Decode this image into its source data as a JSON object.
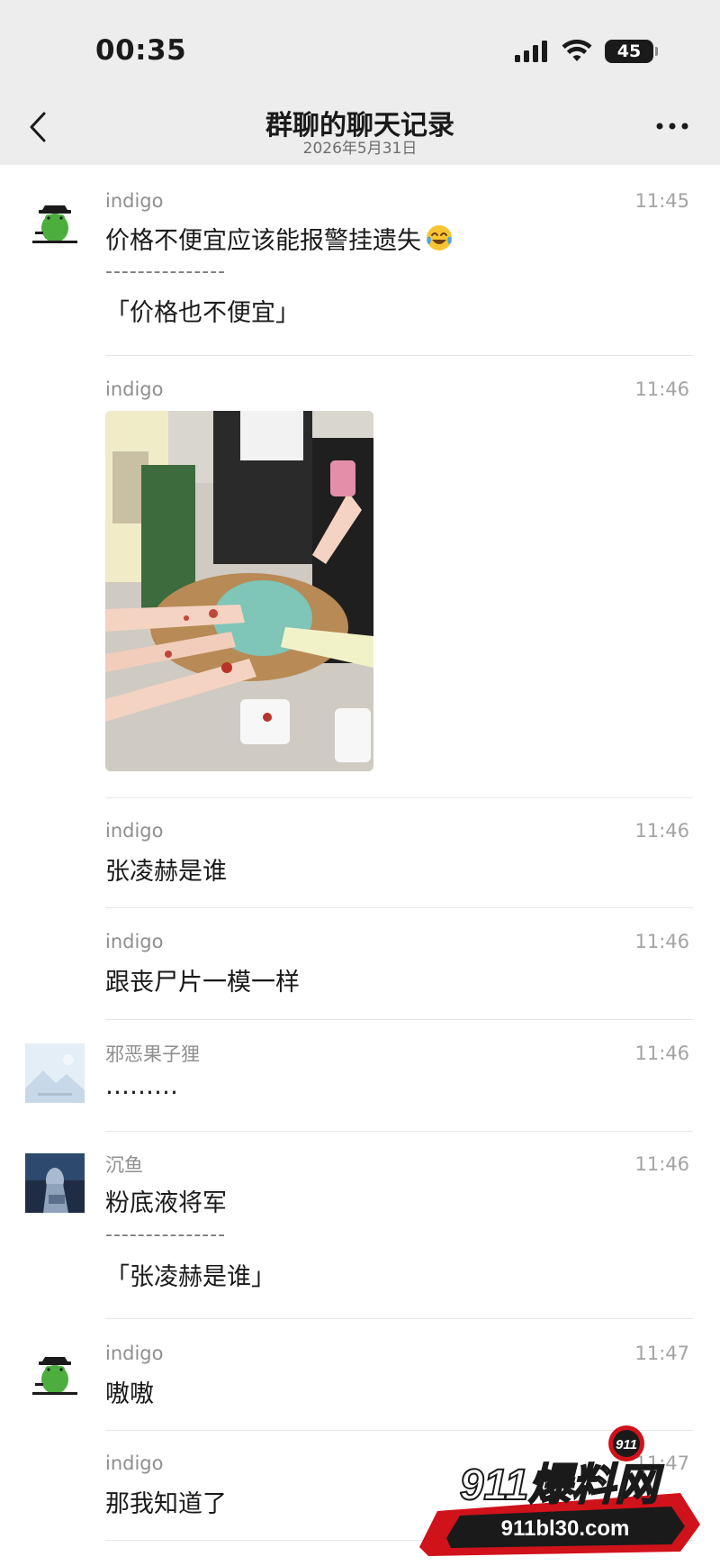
{
  "status": {
    "time": "00:35",
    "battery": "45"
  },
  "nav": {
    "title": "群聊的聊天记录",
    "date": "2026年5月31日"
  },
  "messages": [
    {
      "sender": "indigo",
      "time": "11:45",
      "text": "价格不便宜应该能报警挂遗失",
      "emoji": "tears-of-joy-emoji",
      "divider": "---------------",
      "quote": "「价格也不便宜」"
    },
    {
      "sender": "indigo",
      "time": "11:46",
      "image": "photo-hands-around-bag"
    },
    {
      "sender": "indigo",
      "time": "11:46",
      "text": "张凌赫是谁"
    },
    {
      "sender": "indigo",
      "time": "11:46",
      "text": "跟丧尸片一模一样"
    },
    {
      "sender": "邪恶果子狸",
      "time": "11:46",
      "text": "………"
    },
    {
      "sender": "沉鱼",
      "time": "11:46",
      "text": "粉底液将军",
      "divider": "---------------",
      "quote": "「张凌赫是谁」"
    },
    {
      "sender": "indigo",
      "time": "11:47",
      "text": "嗷嗷"
    },
    {
      "sender": "indigo",
      "time": "11:47",
      "text": "那我知道了"
    }
  ],
  "watermark": {
    "badge": "911",
    "brand": "911爆料网",
    "url": "911bl30.com"
  },
  "colors": {
    "bar_bg": "#ededed",
    "accent_red": "#d0121b",
    "text": "#1a1a1a",
    "meta": "#8f8f8f"
  }
}
